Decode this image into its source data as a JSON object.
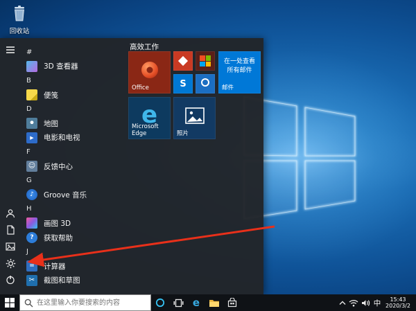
{
  "desktop": {
    "recycle_bin_label": "回收站"
  },
  "start_menu": {
    "rail_icons": [
      "hamburger-menu",
      "user-account",
      "documents",
      "pictures",
      "settings-gear",
      "power"
    ],
    "app_list": [
      {
        "type": "letter",
        "label": "#"
      },
      {
        "type": "app",
        "label": "3D 查看器",
        "icon": "3d-viewer"
      },
      {
        "type": "letter",
        "label": "B"
      },
      {
        "type": "app",
        "label": "便笺",
        "icon": "sticky-notes"
      },
      {
        "type": "letter",
        "label": "D"
      },
      {
        "type": "app",
        "label": "地图",
        "icon": "maps"
      },
      {
        "type": "app",
        "label": "电影和电视",
        "icon": "movies-tv"
      },
      {
        "type": "letter",
        "label": "F"
      },
      {
        "type": "app",
        "label": "反馈中心",
        "icon": "feedback-hub"
      },
      {
        "type": "letter",
        "label": "G"
      },
      {
        "type": "app",
        "label": "Groove 音乐",
        "icon": "groove-music"
      },
      {
        "type": "letter",
        "label": "H"
      },
      {
        "type": "app",
        "label": "画图 3D",
        "icon": "paint-3d"
      },
      {
        "type": "app",
        "label": "获取帮助",
        "icon": "get-help"
      },
      {
        "type": "letter",
        "label": "J"
      },
      {
        "type": "app",
        "label": "计算器",
        "icon": "calculator"
      },
      {
        "type": "app",
        "label": "截图和草图",
        "icon": "snip-sketch"
      }
    ],
    "tiles": {
      "group_title": "高效工作",
      "office": {
        "label": "Office",
        "bg": "#8a2715"
      },
      "small_tiles": {
        "tile1_bg": "#c93a23",
        "tile2_bg": "#5a1f18",
        "tile3_bg": "#0078d4",
        "tile4_bg": "#1b6ec2",
        "skype_letter": "S"
      },
      "mail": {
        "label": "邮件",
        "live_text": "在一处查看所有邮件",
        "bg": "#0078d7"
      },
      "edge": {
        "label": "Microsoft Edge",
        "bg": "#0d3a5f"
      },
      "photos": {
        "label": "照片",
        "bg": "#123a63"
      }
    }
  },
  "taskbar": {
    "search_placeholder": "在这里输入你要搜索的内容",
    "buttons": [
      "start",
      "search",
      "cortana",
      "task-view",
      "microsoft-edge",
      "file-explorer",
      "microsoft-store"
    ],
    "tray_icons": [
      "hidden-icons-chevron",
      "network",
      "volume"
    ],
    "input_method": "中",
    "time": "15:43",
    "date": "2020/3/2"
  },
  "colors": {
    "accent": "#0078d7",
    "annotation_arrow": "#e8301a",
    "taskbar_bg": "#0f1216",
    "start_menu_bg": "#222529"
  },
  "annotation": {
    "type": "red-arrow",
    "points_to": "settings-gear-button"
  }
}
